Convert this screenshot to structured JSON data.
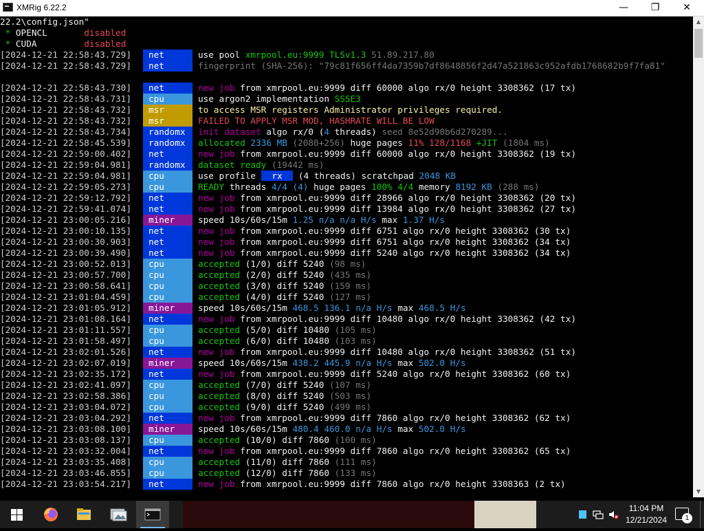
{
  "window": {
    "title": "XMRig 6.22.2",
    "minimize_glyph": "—",
    "maximize_glyph": "❐",
    "close_glyph": "✕"
  },
  "console": {
    "prelude": [
      {
        "segments": [
          {
            "text": "22.2\\config.json\"",
            "color": "white"
          }
        ]
      },
      {
        "segments": [
          {
            "text": " * ",
            "color": "green"
          },
          {
            "text": "OPENCL       ",
            "color": "white"
          },
          {
            "text": "disabled",
            "color": "ltred"
          }
        ]
      },
      {
        "segments": [
          {
            "text": " * ",
            "color": "green"
          },
          {
            "text": "CUDA         ",
            "color": "white"
          },
          {
            "text": "disabled",
            "color": "ltred"
          }
        ]
      }
    ],
    "lines": [
      {
        "ts": "[2024-12-21 22:58:43.729]",
        "tag": "net",
        "tag_class": "net",
        "segments": [
          {
            "text": "use pool ",
            "color": "white"
          },
          {
            "text": "xmrpool.eu:9999 ",
            "color": "green"
          },
          {
            "text": "TLSv1.3 ",
            "color": "green"
          },
          {
            "text": "51.89.217.80",
            "color": "gray"
          }
        ]
      },
      {
        "ts": "[2024-12-21 22:58:43.729]",
        "tag": "net",
        "tag_class": "net",
        "segments": [
          {
            "text": "fingerprint (SHA-256): \"79c81f656ff4da7359b7df8648856f2d47a521863c952afdb1768682b9f7fa81\"",
            "color": "gray"
          }
        ]
      },
      {
        "ts": "",
        "tag": "",
        "tag_class": "",
        "segments": []
      },
      {
        "ts": "[2024-12-21 22:58:43.730]",
        "tag": "net",
        "tag_class": "net",
        "segments": [
          {
            "text": "new job ",
            "color": "magenta"
          },
          {
            "text": "from xmrpool.eu:9999 diff 60000 algo rx/0 height 3308362 (17 tx)",
            "color": "white"
          }
        ]
      },
      {
        "ts": "[2024-12-21 22:58:43.731]",
        "tag": "cpu",
        "tag_class": "cpu",
        "segments": [
          {
            "text": "use argon2 implementation ",
            "color": "white"
          },
          {
            "text": "SSSE3",
            "color": "green"
          }
        ]
      },
      {
        "ts": "[2024-12-21 22:58:43.732]",
        "tag": "msr",
        "tag_class": "msr",
        "segments": [
          {
            "text": "to access MSR registers Administrator privileges required.",
            "color": "yellow"
          }
        ]
      },
      {
        "ts": "[2024-12-21 22:58:43.732]",
        "tag": "msr",
        "tag_class": "msr",
        "segments": [
          {
            "text": "FAILED TO APPLY MSR MOD, HASHRATE WILL BE LOW",
            "color": "red"
          }
        ]
      },
      {
        "ts": "[2024-12-21 22:58:43.734]",
        "tag": "randomx",
        "tag_class": "randomx",
        "segments": [
          {
            "text": "init dataset ",
            "color": "magenta"
          },
          {
            "text": "algo rx/0 (",
            "color": "white"
          },
          {
            "text": "4",
            "color": "cyan"
          },
          {
            "text": " threads) ",
            "color": "white"
          },
          {
            "text": "seed 8e52d90b6d270289...",
            "color": "gray"
          }
        ]
      },
      {
        "ts": "[2024-12-21 22:58:45.539]",
        "tag": "randomx",
        "tag_class": "randomx",
        "segments": [
          {
            "text": "allocated ",
            "color": "green"
          },
          {
            "text": "2336 MB ",
            "color": "cyan"
          },
          {
            "text": "(2080+256) ",
            "color": "gray"
          },
          {
            "text": "huge pages ",
            "color": "white"
          },
          {
            "text": "11% 128/1168 ",
            "color": "ltred"
          },
          {
            "text": "+JIT ",
            "color": "green"
          },
          {
            "text": "(1804 ms)",
            "color": "gray"
          }
        ]
      },
      {
        "ts": "[2024-12-21 22:59:00.402]",
        "tag": "net",
        "tag_class": "net",
        "segments": [
          {
            "text": "new job ",
            "color": "magenta"
          },
          {
            "text": "from xmrpool.eu:9999 diff 60000 algo rx/0 height 3308362 (19 tx)",
            "color": "white"
          }
        ]
      },
      {
        "ts": "[2024-12-21 22:59:04.981]",
        "tag": "randomx",
        "tag_class": "randomx",
        "segments": [
          {
            "text": "dataset ready ",
            "color": "green"
          },
          {
            "text": "(19442 ms)",
            "color": "gray"
          }
        ]
      },
      {
        "ts": "[2024-12-21 22:59:04.981]",
        "tag": "cpu",
        "tag_class": "cpu",
        "segments": [
          {
            "text": "use profile ",
            "color": "white"
          },
          {
            "text": " rx ",
            "color": "rxbox"
          },
          {
            "text": " (4 threads) scratchpad ",
            "color": "white"
          },
          {
            "text": "2048 KB",
            "color": "cyan"
          }
        ]
      },
      {
        "ts": "[2024-12-21 22:59:05.273]",
        "tag": "cpu",
        "tag_class": "cpu",
        "segments": [
          {
            "text": "READY ",
            "color": "green"
          },
          {
            "text": "threads ",
            "color": "white"
          },
          {
            "text": "4/4 (4) ",
            "color": "cyan"
          },
          {
            "text": "huge pages ",
            "color": "white"
          },
          {
            "text": "100% 4/4 ",
            "color": "green"
          },
          {
            "text": "memory ",
            "color": "white"
          },
          {
            "text": "8192 KB ",
            "color": "cyan"
          },
          {
            "text": "(288 ms)",
            "color": "gray"
          }
        ]
      },
      {
        "ts": "[2024-12-21 22:59:12.792]",
        "tag": "net",
        "tag_class": "net",
        "segments": [
          {
            "text": "new job ",
            "color": "magenta"
          },
          {
            "text": "from xmrpool.eu:9999 diff 28966 algo rx/0 height 3308362 (20 tx)",
            "color": "white"
          }
        ]
      },
      {
        "ts": "[2024-12-21 22:59:41.074]",
        "tag": "net",
        "tag_class": "net",
        "segments": [
          {
            "text": "new job ",
            "color": "magenta"
          },
          {
            "text": "from xmrpool.eu:9999 diff 13984 algo rx/0 height 3308362 (27 tx)",
            "color": "white"
          }
        ]
      },
      {
        "ts": "[2024-12-21 23:00:05.216]",
        "tag": "miner",
        "tag_class": "miner",
        "segments": [
          {
            "text": "speed 10s/60s/15m ",
            "color": "white"
          },
          {
            "text": "1.25 ",
            "color": "cyan"
          },
          {
            "text": "n/a n/a ",
            "color": "cyan"
          },
          {
            "text": "H/s ",
            "color": "cyan"
          },
          {
            "text": "max ",
            "color": "white"
          },
          {
            "text": "1.37 H/s",
            "color": "cyan"
          }
        ]
      },
      {
        "ts": "[2024-12-21 23:00:10.135]",
        "tag": "net",
        "tag_class": "net",
        "segments": [
          {
            "text": "new job ",
            "color": "magenta"
          },
          {
            "text": "from xmrpool.eu:9999 diff 6751 algo rx/0 height 3308362 (30 tx)",
            "color": "white"
          }
        ]
      },
      {
        "ts": "[2024-12-21 23:00:30.903]",
        "tag": "net",
        "tag_class": "net",
        "segments": [
          {
            "text": "new job ",
            "color": "magenta"
          },
          {
            "text": "from xmrpool.eu:9999 diff 6751 algo rx/0 height 3308362 (34 tx)",
            "color": "white"
          }
        ]
      },
      {
        "ts": "[2024-12-21 23:00:39.490]",
        "tag": "net",
        "tag_class": "net",
        "segments": [
          {
            "text": "new job ",
            "color": "magenta"
          },
          {
            "text": "from xmrpool.eu:9999 diff 5240 algo rx/0 height 3308362 (34 tx)",
            "color": "white"
          }
        ]
      },
      {
        "ts": "[2024-12-21 23:00:52.013]",
        "tag": "cpu",
        "tag_class": "cpu",
        "segments": [
          {
            "text": "accepted ",
            "color": "green"
          },
          {
            "text": "(1/0) diff 5240 ",
            "color": "white"
          },
          {
            "text": "(98 ms)",
            "color": "gray"
          }
        ]
      },
      {
        "ts": "[2024-12-21 23:00:57.700]",
        "tag": "cpu",
        "tag_class": "cpu",
        "segments": [
          {
            "text": "accepted ",
            "color": "green"
          },
          {
            "text": "(2/0) diff 5240 ",
            "color": "white"
          },
          {
            "text": "(435 ms)",
            "color": "gray"
          }
        ]
      },
      {
        "ts": "[2024-12-21 23:00:58.641]",
        "tag": "cpu",
        "tag_class": "cpu",
        "segments": [
          {
            "text": "accepted ",
            "color": "green"
          },
          {
            "text": "(3/0) diff 5240 ",
            "color": "white"
          },
          {
            "text": "(159 ms)",
            "color": "gray"
          }
        ]
      },
      {
        "ts": "[2024-12-21 23:01:04.459]",
        "tag": "cpu",
        "tag_class": "cpu",
        "segments": [
          {
            "text": "accepted ",
            "color": "green"
          },
          {
            "text": "(4/0) diff 5240 ",
            "color": "white"
          },
          {
            "text": "(127 ms)",
            "color": "gray"
          }
        ]
      },
      {
        "ts": "[2024-12-21 23:01:05.912]",
        "tag": "miner",
        "tag_class": "miner",
        "segments": [
          {
            "text": "speed 10s/60s/15m ",
            "color": "white"
          },
          {
            "text": "468.5 ",
            "color": "cyan"
          },
          {
            "text": "136.1 ",
            "color": "cyan"
          },
          {
            "text": "n/a ",
            "color": "cyan"
          },
          {
            "text": "H/s ",
            "color": "cyan"
          },
          {
            "text": "max ",
            "color": "white"
          },
          {
            "text": "468.5 H/s",
            "color": "cyan"
          }
        ]
      },
      {
        "ts": "[2024-12-21 23:01:08.164]",
        "tag": "net",
        "tag_class": "net",
        "segments": [
          {
            "text": "new job ",
            "color": "magenta"
          },
          {
            "text": "from xmrpool.eu:9999 diff 10480 algo rx/0 height 3308362 (42 tx)",
            "color": "white"
          }
        ]
      },
      {
        "ts": "[2024-12-21 23:01:11.557]",
        "tag": "cpu",
        "tag_class": "cpu",
        "segments": [
          {
            "text": "accepted ",
            "color": "green"
          },
          {
            "text": "(5/0) diff 10480 ",
            "color": "white"
          },
          {
            "text": "(105 ms)",
            "color": "gray"
          }
        ]
      },
      {
        "ts": "[2024-12-21 23:01:58.497]",
        "tag": "cpu",
        "tag_class": "cpu",
        "segments": [
          {
            "text": "accepted ",
            "color": "green"
          },
          {
            "text": "(6/0) diff 10480 ",
            "color": "white"
          },
          {
            "text": "(103 ms)",
            "color": "gray"
          }
        ]
      },
      {
        "ts": "[2024-12-21 23:02:01.526]",
        "tag": "net",
        "tag_class": "net",
        "segments": [
          {
            "text": "new job ",
            "color": "magenta"
          },
          {
            "text": "from xmrpool.eu:9999 diff 10480 algo rx/0 height 3308362 (51 tx)",
            "color": "white"
          }
        ]
      },
      {
        "ts": "[2024-12-21 23:02:07.019]",
        "tag": "miner",
        "tag_class": "miner",
        "segments": [
          {
            "text": "speed 10s/60s/15m ",
            "color": "white"
          },
          {
            "text": "438.2 ",
            "color": "cyan"
          },
          {
            "text": "445.9 ",
            "color": "cyan"
          },
          {
            "text": "n/a ",
            "color": "cyan"
          },
          {
            "text": "H/s ",
            "color": "cyan"
          },
          {
            "text": "max ",
            "color": "white"
          },
          {
            "text": "502.0 H/s",
            "color": "cyan"
          }
        ]
      },
      {
        "ts": "[2024-12-21 23:02:35.172]",
        "tag": "net",
        "tag_class": "net",
        "segments": [
          {
            "text": "new job ",
            "color": "magenta"
          },
          {
            "text": "from xmrpool.eu:9999 diff 5240 algo rx/0 height 3308362 (60 tx)",
            "color": "white"
          }
        ]
      },
      {
        "ts": "[2024-12-21 23:02:41.097]",
        "tag": "cpu",
        "tag_class": "cpu",
        "segments": [
          {
            "text": "accepted ",
            "color": "green"
          },
          {
            "text": "(7/0) diff 5240 ",
            "color": "white"
          },
          {
            "text": "(107 ms)",
            "color": "gray"
          }
        ]
      },
      {
        "ts": "[2024-12-21 23:02:58.386]",
        "tag": "cpu",
        "tag_class": "cpu",
        "segments": [
          {
            "text": "accepted ",
            "color": "green"
          },
          {
            "text": "(8/0) diff 5240 ",
            "color": "white"
          },
          {
            "text": "(503 ms)",
            "color": "gray"
          }
        ]
      },
      {
        "ts": "[2024-12-21 23:03:04.072]",
        "tag": "cpu",
        "tag_class": "cpu",
        "segments": [
          {
            "text": "accepted ",
            "color": "green"
          },
          {
            "text": "(9/0) diff 5240 ",
            "color": "white"
          },
          {
            "text": "(499 ms)",
            "color": "gray"
          }
        ]
      },
      {
        "ts": "[2024-12-21 23:03:04.292]",
        "tag": "net",
        "tag_class": "net",
        "segments": [
          {
            "text": "new job ",
            "color": "magenta"
          },
          {
            "text": "from xmrpool.eu:9999 diff 7860 algo rx/0 height 3308362 (62 tx)",
            "color": "white"
          }
        ]
      },
      {
        "ts": "[2024-12-21 23:03:08.100]",
        "tag": "miner",
        "tag_class": "miner",
        "segments": [
          {
            "text": "speed 10s/60s/15m ",
            "color": "white"
          },
          {
            "text": "480.4 ",
            "color": "cyan"
          },
          {
            "text": "460.0 ",
            "color": "cyan"
          },
          {
            "text": "n/a ",
            "color": "cyan"
          },
          {
            "text": "H/s ",
            "color": "cyan"
          },
          {
            "text": "max ",
            "color": "white"
          },
          {
            "text": "502.0 H/s",
            "color": "cyan"
          }
        ]
      },
      {
        "ts": "[2024-12-21 23:03:08.137]",
        "tag": "cpu",
        "tag_class": "cpu",
        "segments": [
          {
            "text": "accepted ",
            "color": "green"
          },
          {
            "text": "(10/0) diff 7860 ",
            "color": "white"
          },
          {
            "text": "(100 ms)",
            "color": "gray"
          }
        ]
      },
      {
        "ts": "[2024-12-21 23:03:32.004]",
        "tag": "net",
        "tag_class": "net",
        "segments": [
          {
            "text": "new job ",
            "color": "magenta"
          },
          {
            "text": "from xmrpool.eu:9999 diff 7860 algo rx/0 height 3308362 (65 tx)",
            "color": "white"
          }
        ]
      },
      {
        "ts": "[2024-12-21 23:03:35.408]",
        "tag": "cpu",
        "tag_class": "cpu",
        "segments": [
          {
            "text": "accepted ",
            "color": "green"
          },
          {
            "text": "(11/0) diff 7860 ",
            "color": "white"
          },
          {
            "text": "(111 ms)",
            "color": "gray"
          }
        ]
      },
      {
        "ts": "[2024-12-21 23:03:46.855]",
        "tag": "cpu",
        "tag_class": "cpu",
        "segments": [
          {
            "text": "accepted ",
            "color": "green"
          },
          {
            "text": "(12/0) diff 7860 ",
            "color": "white"
          },
          {
            "text": "(133 ms)",
            "color": "gray"
          }
        ]
      },
      {
        "ts": "[2024-12-21 23:03:54.217]",
        "tag": "net",
        "tag_class": "net",
        "segments": [
          {
            "text": "new job ",
            "color": "magenta"
          },
          {
            "text": "from xmrpool.eu:9999 diff 7860 algo rx/0 height 3308363 (2 tx)",
            "color": "white"
          }
        ]
      }
    ]
  },
  "taskbar": {
    "apps": [
      {
        "name": "firefox-icon",
        "active": false
      },
      {
        "name": "file-explorer-icon",
        "active": false
      },
      {
        "name": "photos-icon",
        "active": false
      },
      {
        "name": "command-prompt-icon",
        "active": true
      }
    ],
    "clock_time": "11:04 PM",
    "clock_date": "12/21/2024",
    "notification_count": "1"
  },
  "colors": {
    "tag_net": "#0037da",
    "tag_cpu": "#3a96dd",
    "tag_msr": "#c19c00",
    "tag_randomx": "#0037da",
    "tag_miner": "#881798",
    "taskbar_bg": "#1c1c1c"
  }
}
